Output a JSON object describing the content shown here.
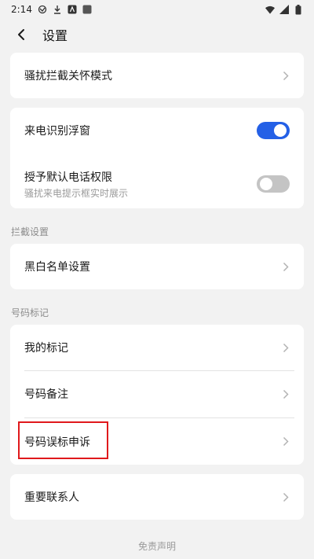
{
  "status_bar": {
    "time": "2:14",
    "left_icons": [
      "missed-call-icon",
      "download-icon",
      "app-a-icon",
      "app-square-icon"
    ],
    "right_icons": [
      "wifi-icon",
      "signal-icon",
      "battery-icon"
    ]
  },
  "header": {
    "title": "设置"
  },
  "items": {
    "harassment_mode": "骚扰拦截关怀模式",
    "caller_id_float": "来电识别浮窗",
    "default_phone_permission": "授予默认电话权限",
    "default_phone_permission_sub": "骚扰来电提示框实时展示"
  },
  "toggles": {
    "caller_id_float_on": true,
    "default_phone_permission_on": false
  },
  "sections": {
    "intercept": "拦截设置",
    "number_mark": "号码标记"
  },
  "intercept_items": {
    "blacklist": "黑白名单设置"
  },
  "mark_items": {
    "my_marks": "我的标记",
    "number_notes": "号码备注",
    "mislabel_appeal": "号码误标申诉"
  },
  "contacts": {
    "important_contacts": "重要联系人"
  },
  "footer": {
    "disclaimer": "免责声明"
  },
  "colors": {
    "accent": "#2460e6",
    "highlight_border": "#e0191c",
    "background": "#f2f2f2"
  }
}
